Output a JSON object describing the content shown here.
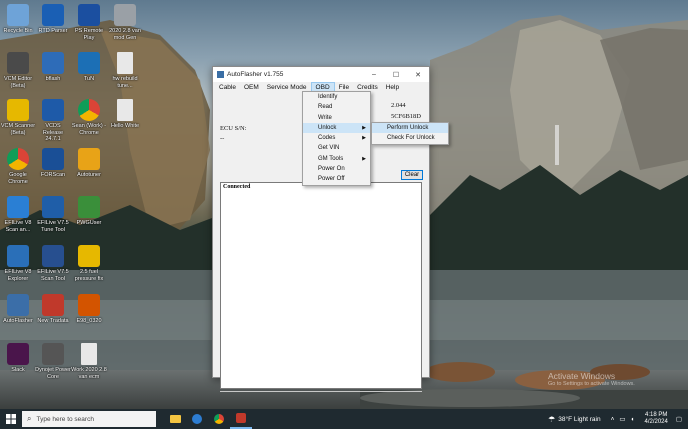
{
  "desktop_icons": [
    {
      "label": "Recycle Bin",
      "icon": "recycle-bin-icon",
      "color": "#6ea3d8"
    },
    {
      "label": "RTD Parser",
      "icon": "rtd-icon",
      "color": "#1a5fb4"
    },
    {
      "label": "PS Remote Play",
      "icon": "ps-remote-icon",
      "color": "#1b4fa0"
    },
    {
      "label": "2020 2.8 van mod Gen",
      "icon": "wrench-icon",
      "color": "#9aa0a6"
    },
    {
      "label": "VCM Editor (Beta)",
      "icon": "vcm-editor-icon",
      "color": "#4a4a4a"
    },
    {
      "label": "bflash",
      "icon": "bflash-icon",
      "color": "#2e6cb8"
    },
    {
      "label": "TuN",
      "icon": "tun-icon",
      "color": "#1c6fb5"
    },
    {
      "label": "hw rebuild tune...",
      "icon": "document-icon",
      "color": "#e8e8e8"
    },
    {
      "label": "VCM Scanner (Beta)",
      "icon": "vcm-scanner-icon",
      "color": "#e6b800"
    },
    {
      "label": "VCDS Release 24.7.1",
      "icon": "vcds-icon",
      "color": "#1e5aa8"
    },
    {
      "label": "Sean (Work) - Chrome",
      "icon": "chrome-profile-icon",
      "color": "#e04c3c"
    },
    {
      "label": "Hello White",
      "icon": "document-icon",
      "color": "#e8e8e8"
    },
    {
      "label": "Google Chrome",
      "icon": "chrome-icon",
      "color": "#db4437"
    },
    {
      "label": "FORScan",
      "icon": "forscan-icon",
      "color": "#1a4f96"
    },
    {
      "label": "Autotuner",
      "icon": "autotuner-icon",
      "color": "#e8a317"
    },
    {
      "label": "EFILive V8 Scan an...",
      "icon": "efilive-icon",
      "color": "#2a7fd4"
    },
    {
      "label": "EFILive V7.5 Tune Tool",
      "icon": "efilive-tune-icon",
      "color": "#1f5ea8"
    },
    {
      "label": "PWGUser",
      "icon": "pwg-icon",
      "color": "#3a8f3a"
    },
    {
      "label": "EFILive V8 Explorer",
      "icon": "efilive-explorer-icon",
      "color": "#2a6fb8"
    },
    {
      "label": "EFILive V7.5 Scan Tool",
      "icon": "efilive-scan-icon",
      "color": "#274f8f"
    },
    {
      "label": "2.5 fuel pressure fix",
      "icon": "lightning-icon",
      "color": "#e6b800"
    },
    {
      "label": "AutoFlasher",
      "icon": "autoflasher-icon",
      "color": "#3b6ea8"
    },
    {
      "label": "New Tradata",
      "icon": "tradata-icon",
      "color": "#c0392b"
    },
    {
      "label": "E98_0320",
      "icon": "e98-icon",
      "color": "#d35400"
    },
    {
      "label": "Slack",
      "icon": "slack-icon",
      "color": "#4a154b"
    },
    {
      "label": "Dynojet Power Core",
      "icon": "dynojet-icon",
      "color": "#555555"
    },
    {
      "label": "Work 2020 2.8 van ecm",
      "icon": "document-icon",
      "color": "#e8e8e8"
    }
  ],
  "window": {
    "title": "AutoFlasher v1.755",
    "controls": {
      "minimize": "–",
      "maximize": "☐",
      "close": "✕"
    },
    "menubar": [
      "Cable",
      "OEM",
      "Service Mode",
      "OBD",
      "File",
      "Credits",
      "Help"
    ],
    "active_menu": "OBD",
    "fields": {
      "value1": "2.044",
      "value2": "5CF6B18D",
      "ecu_sn_label": "ECU S/N:",
      "ecu_sn_value": "--"
    },
    "clear_label": "Clear",
    "log_text": "Connected"
  },
  "obd_menu": {
    "items": [
      {
        "label": "Identify",
        "submenu": false
      },
      {
        "label": "Read",
        "submenu": false
      },
      {
        "label": "Write",
        "submenu": false
      },
      {
        "label": "Unlock",
        "submenu": true,
        "highlighted": true
      },
      {
        "label": "Codes",
        "submenu": true
      },
      {
        "label": "Get VIN",
        "submenu": false
      },
      {
        "label": "GM Tools",
        "submenu": true
      },
      {
        "label": "Power On",
        "submenu": false
      },
      {
        "label": "Power Off",
        "submenu": false
      }
    ],
    "unlock_submenu": [
      {
        "label": "Perform Unlock",
        "highlighted": true
      },
      {
        "label": "Check For Unlock",
        "highlighted": false
      }
    ]
  },
  "watermark": {
    "line1": "Activate Windows",
    "line2": "Go to Settings to activate Windows."
  },
  "taskbar": {
    "search_placeholder": "Type here to search",
    "weather": "38°F  Light rain",
    "time": "4:18 PM",
    "date": "4/2/2024"
  },
  "colors": {
    "menu_highlight": "#cce4f7",
    "taskbar": "#1f2a30",
    "accent": "#0078d7"
  }
}
